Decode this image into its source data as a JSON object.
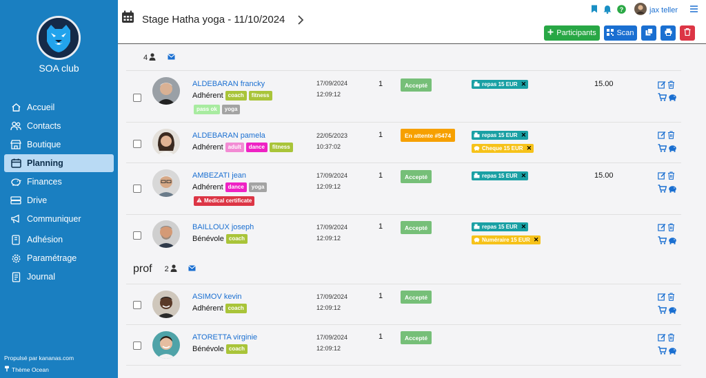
{
  "sidebar": {
    "club_name": "SOA club",
    "items": [
      {
        "label": "Accueil",
        "icon": "home-icon"
      },
      {
        "label": "Contacts",
        "icon": "users-icon"
      },
      {
        "label": "Boutique",
        "icon": "store-icon"
      },
      {
        "label": "Planning",
        "icon": "calendar-icon",
        "active": true
      },
      {
        "label": "Finances",
        "icon": "piggy-bank-icon"
      },
      {
        "label": "Drive",
        "icon": "drive-icon"
      },
      {
        "label": "Communiquer",
        "icon": "megaphone-icon"
      },
      {
        "label": "Adhésion",
        "icon": "id-card-icon"
      },
      {
        "label": "Paramétrage",
        "icon": "gear-icon"
      },
      {
        "label": "Journal",
        "icon": "journal-icon"
      }
    ],
    "footer_powered": "Propulsé par kananas.com",
    "footer_theme": "Thème Ocean"
  },
  "header": {
    "title": "Stage Hatha yoga - 11/10/2024",
    "user_name": "jax teller",
    "buttons": {
      "participants": "Participants",
      "scan": "Scan"
    }
  },
  "groups": {
    "first": {
      "count": "4"
    },
    "prof": {
      "label": "prof",
      "count": "2"
    }
  },
  "rows": [
    {
      "name": "ALDEBARAN francky",
      "role": "Adhérent",
      "tags": [
        "coach",
        "fitness",
        "pass ok",
        "yoga"
      ],
      "date": "17/09/2024",
      "time": "12:09:12",
      "qty": "1",
      "status": "Accepté",
      "payments": [
        "repas 15 EUR"
      ],
      "amount": "15.00"
    },
    {
      "name": "ALDEBARAN pamela",
      "role": "Adhérent",
      "tags": [
        "adult",
        "dance",
        "fitness"
      ],
      "date": "22/05/2023",
      "time": "10:37:02",
      "qty": "1",
      "status": "En attente #5474",
      "payments": [
        "repas 15 EUR",
        "Cheque 15 EUR"
      ],
      "amount": ""
    },
    {
      "name": "AMBEZATI jean",
      "role": "Adhérent",
      "tags": [
        "dance",
        "yoga"
      ],
      "extra_tag": "Medical certificate",
      "date": "17/09/2024",
      "time": "12:09:12",
      "qty": "1",
      "status": "Accepté",
      "payments": [
        "repas 15 EUR"
      ],
      "amount": "15.00"
    },
    {
      "name": "BAILLOUX joseph",
      "role": "Bénévole",
      "tags": [
        "coach"
      ],
      "date": "17/09/2024",
      "time": "12:09:12",
      "qty": "1",
      "status": "Accepté",
      "payments": [
        "repas 15 EUR",
        "Numéraire 15 EUR"
      ],
      "amount": ""
    },
    {
      "name": "ASIMOV kevin",
      "role": "Adhérent",
      "tags": [
        "coach"
      ],
      "date": "17/09/2024",
      "time": "12:09:12",
      "qty": "1",
      "status": "Accepté",
      "payments": [],
      "amount": ""
    },
    {
      "name": "ATORETTA virginie",
      "role": "Bénévole",
      "tags": [
        "coach"
      ],
      "date": "17/09/2024",
      "time": "12:09:12",
      "qty": "1",
      "status": "Accepté",
      "payments": [],
      "amount": ""
    }
  ],
  "colors": {
    "sidebar": "#1a7fc1",
    "accent": "#1a6fd1",
    "accepted": "#76bf78",
    "pending": "#f6a000",
    "payment": "#1aa0a4",
    "cheque": "#f6c21a",
    "delete": "#dc3545",
    "add": "#28a745"
  }
}
